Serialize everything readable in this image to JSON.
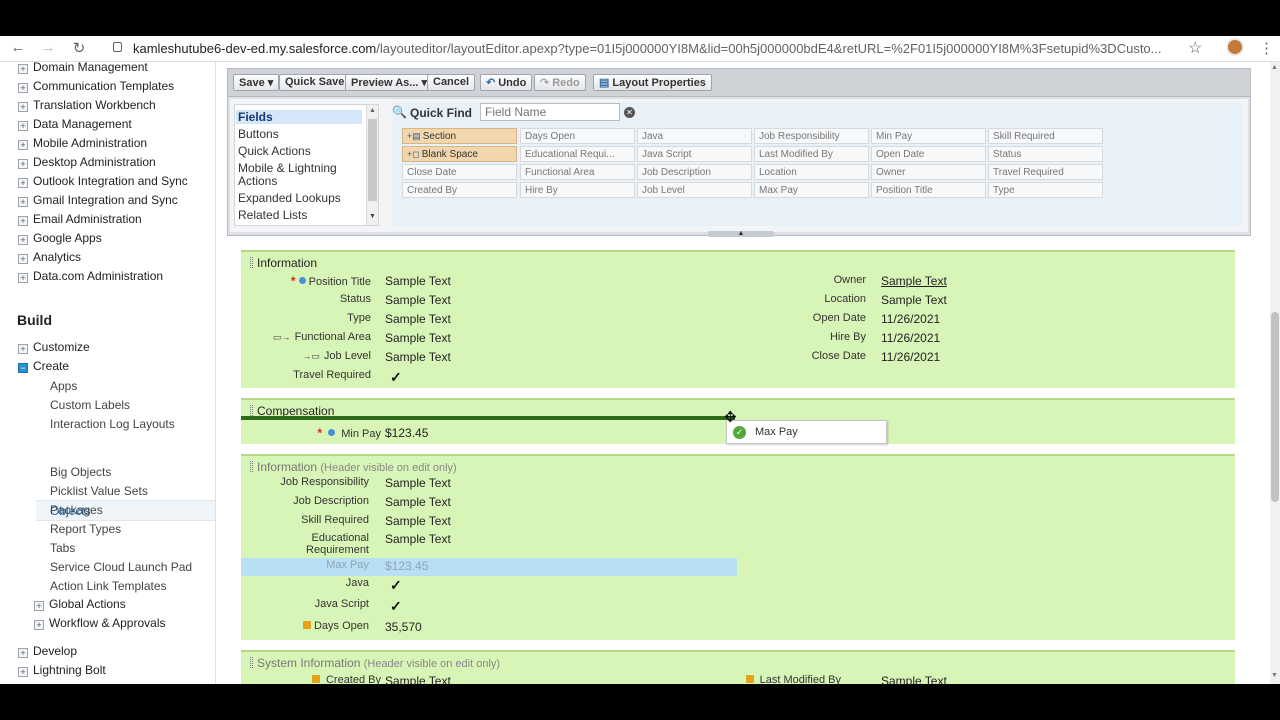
{
  "browser": {
    "url_host": "kamleshutube6-dev-ed.my.salesforce.com",
    "url_path": "/layouteditor/layoutEditor.apexp?type=01I5j000000YI8M&lid=00h5j000000bdE4&retURL=%2F01I5j000000YI8M%3Fsetupid%3DCusto..."
  },
  "sidebar": {
    "top_items": [
      "Domain Management",
      "Communication Templates",
      "Translation Workbench",
      "Data Management",
      "Mobile Administration",
      "Desktop Administration",
      "Outlook Integration and Sync",
      "Gmail Integration and Sync",
      "Email Administration",
      "Google Apps",
      "Analytics",
      "Data.com Administration"
    ],
    "build_heading": "Build",
    "customize": "Customize",
    "create": "Create",
    "create_children": [
      "Apps",
      "Custom Labels",
      "Interaction Log Layouts",
      "Objects",
      "Big Objects",
      "Picklist Value Sets",
      "Packages",
      "Report Types",
      "Tabs",
      "Service Cloud Launch Pad",
      "Action Link Templates"
    ],
    "global_actions": "Global Actions",
    "workflow": "Workflow & Approvals",
    "develop": "Develop",
    "lightning_bolt": "Lightning Bolt"
  },
  "toolbar": {
    "save": "Save",
    "quick_save": "Quick Save",
    "preview_as": "Preview As...",
    "cancel": "Cancel",
    "undo": "Undo",
    "redo": "Redo",
    "layout_properties": "Layout Properties"
  },
  "palette": {
    "categories": [
      "Fields",
      "Buttons",
      "Quick Actions",
      "Mobile & Lightning",
      "Actions",
      "Expanded Lookups",
      "Related Lists"
    ],
    "quick_find_label": "Quick Find",
    "quick_find_placeholder": "Field Name",
    "fields": [
      [
        "Section",
        "Days Open",
        "Java",
        "Job Responsibility",
        "Min Pay",
        "Skill Required"
      ],
      [
        "Blank Space",
        "Educational Requi...",
        "Java Script",
        "Last Modified By",
        "Open Date",
        "Status"
      ],
      [
        "Close Date",
        "Functional Area",
        "Job Description",
        "Location",
        "Owner",
        "Travel Required"
      ],
      [
        "Created By",
        "Hire By",
        "Job Level",
        "Max Pay",
        "Position Title",
        "Type"
      ]
    ]
  },
  "layout": {
    "info": {
      "title": "Information",
      "left": [
        {
          "label": "Position Title",
          "value": "Sample Text"
        },
        {
          "label": "Status",
          "value": "Sample Text"
        },
        {
          "label": "Type",
          "value": "Sample Text"
        },
        {
          "label": "Functional Area",
          "value": "Sample Text"
        },
        {
          "label": "Job Level",
          "value": "Sample Text"
        },
        {
          "label": "Travel Required",
          "value": "✓"
        }
      ],
      "right": [
        {
          "label": "Owner",
          "value": "Sample Text"
        },
        {
          "label": "Location",
          "value": "Sample Text"
        },
        {
          "label": "Open Date",
          "value": "11/26/2021"
        },
        {
          "label": "Hire By",
          "value": "11/26/2021"
        },
        {
          "label": "Close Date",
          "value": "11/26/2021"
        }
      ]
    },
    "comp": {
      "title": "Compensation",
      "min_pay_label": "Min Pay",
      "min_pay_value": "$123.45",
      "drag_label": "Max Pay"
    },
    "info2": {
      "title": "Information",
      "note": "(Header visible on edit only)",
      "rows": [
        {
          "label": "Job Responsibility",
          "value": "Sample Text"
        },
        {
          "label": "Job Description",
          "value": "Sample Text"
        },
        {
          "label": "Skill Required",
          "value": "Sample Text"
        },
        {
          "label": "Educational Requirement",
          "value": "Sample Text"
        },
        {
          "label": "Max Pay",
          "value": "$123.45"
        },
        {
          "label": "Java",
          "value": "✓"
        },
        {
          "label": "Java Script",
          "value": "✓"
        },
        {
          "label": "Days Open",
          "value": "35,570"
        }
      ]
    },
    "sys": {
      "title": "System Information",
      "note": "(Header visible on edit only)",
      "created_by_label": "Created By",
      "created_by_value": "Sample Text",
      "last_mod_label": "Last Modified By",
      "last_mod_value": "Sample Text"
    }
  }
}
